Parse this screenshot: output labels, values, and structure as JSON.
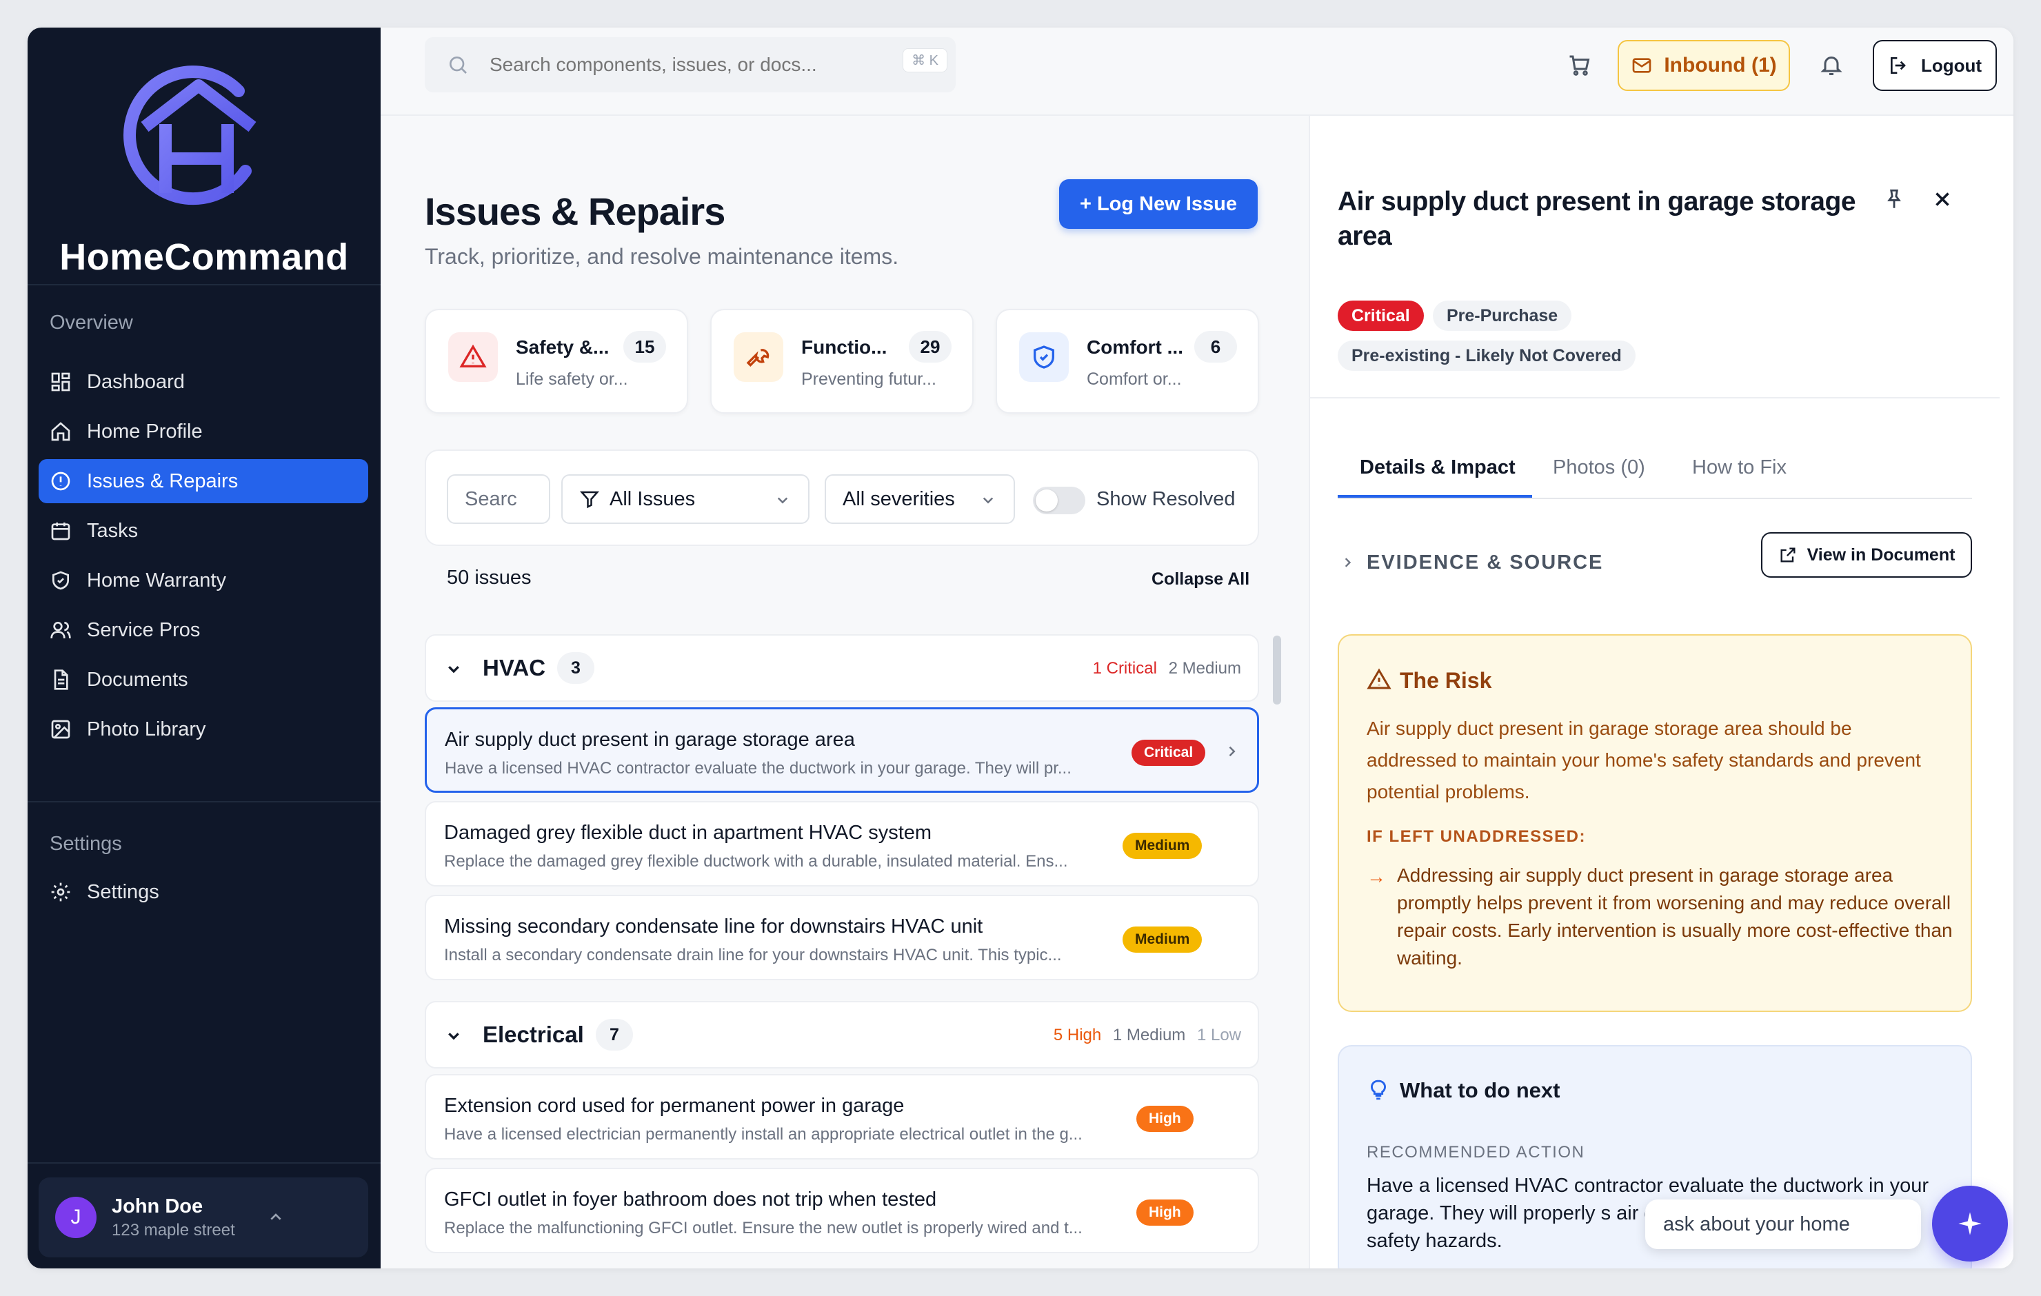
{
  "brand": {
    "name": "HomeCommand",
    "colors": {
      "logo": "#6d6cf5",
      "accent": "#2563eb"
    }
  },
  "sidebar": {
    "overview_label": "Overview",
    "items": [
      {
        "label": "Dashboard",
        "icon": "grid-icon"
      },
      {
        "label": "Home Profile",
        "icon": "home-icon"
      },
      {
        "label": "Issues & Repairs",
        "icon": "alert-circle-icon",
        "active": true
      },
      {
        "label": "Tasks",
        "icon": "calendar-icon"
      },
      {
        "label": "Home Warranty",
        "icon": "shield-check-icon"
      },
      {
        "label": "Service Pros",
        "icon": "users-icon"
      },
      {
        "label": "Documents",
        "icon": "document-icon"
      },
      {
        "label": "Photo Library",
        "icon": "image-icon"
      }
    ],
    "settings_section": "Settings",
    "settings_item": "Settings",
    "user": {
      "initial": "J",
      "name": "John Doe",
      "address": "123 maple street"
    }
  },
  "topbar": {
    "search_placeholder": "Search components, issues, or docs...",
    "shortcut": "⌘ K",
    "inbound_label": "Inbound",
    "inbound_count": "(1)",
    "logout_label": "Logout"
  },
  "main": {
    "title": "Issues & Repairs",
    "subtitle": "Track, prioritize, and resolve maintenance items.",
    "log_button": "+ Log New Issue",
    "stats": [
      {
        "name": "Safety &...",
        "count": "15",
        "desc": "Life safety or...",
        "icon": "warning-triangle-icon",
        "color": "#dc2626",
        "bg": "#fdecec"
      },
      {
        "name": "Functio...",
        "count": "29",
        "desc": "Preventing futur...",
        "icon": "wrench-icon",
        "color": "#c2410c",
        "bg": "#fff3e0"
      },
      {
        "name": "Comfort ...",
        "count": "6",
        "desc": "Comfort or...",
        "icon": "shield-check-icon",
        "color": "#2563eb",
        "bg": "#eaf1fe"
      }
    ],
    "filters": {
      "search_placeholder": "Searc",
      "type_value": "All Issues",
      "severity_value": "All severities",
      "show_resolved_label": "Show Resolved"
    },
    "issues_count": "50 issues",
    "collapse_all": "Collapse All",
    "groups": [
      {
        "name": "HVAC",
        "count": "3",
        "summary": [
          {
            "text": "1 Critical",
            "kind": "crit"
          },
          {
            "text": "2 Medium",
            "kind": "med"
          }
        ],
        "issues": [
          {
            "title": "Air supply duct present in garage storage area",
            "desc": "Have a licensed HVAC contractor evaluate the ductwork in your garage. They will pr...",
            "severity": "Critical",
            "selected": true
          },
          {
            "title": "Damaged grey flexible duct in apartment HVAC system",
            "desc": "Replace the damaged grey flexible ductwork with a durable, insulated material. Ens...",
            "severity": "Medium"
          },
          {
            "title": "Missing secondary condensate line for downstairs HVAC unit",
            "desc": "Install a secondary condensate drain line for your downstairs HVAC unit. This typic...",
            "severity": "Medium"
          }
        ]
      },
      {
        "name": "Electrical",
        "count": "7",
        "summary": [
          {
            "text": "5 High",
            "kind": "high"
          },
          {
            "text": "1 Medium",
            "kind": "med"
          },
          {
            "text": "1 Low",
            "kind": "low"
          }
        ],
        "issues": [
          {
            "title": "Extension cord used for permanent power in garage",
            "desc": "Have a licensed electrician permanently install an appropriate electrical outlet in the g...",
            "severity": "High"
          },
          {
            "title": "GFCI outlet in foyer bathroom does not trip when tested",
            "desc": "Replace the malfunctioning GFCI outlet. Ensure the new outlet is properly wired and t...",
            "severity": "High"
          }
        ]
      }
    ]
  },
  "detail": {
    "title": "Air supply duct present in garage storage area",
    "tags": [
      "Critical",
      "Pre-Purchase",
      "Pre-existing - Likely Not Covered"
    ],
    "tabs": [
      "Details & Impact",
      "Photos (0)",
      "How to Fix"
    ],
    "evidence_label": "EVIDENCE & SOURCE",
    "view_doc": "View in Document",
    "risk": {
      "title": "The Risk",
      "body": "Air supply duct present in garage storage area should be addressed to maintain your home's safety standards and prevent potential problems.",
      "subheading": "IF LEFT UNADDRESSED:",
      "consequence": "Addressing air supply duct present in garage storage area promptly helps prevent it from worsening and may reduce overall repair costs. Early intervention is usually more cost-effective than waiting."
    },
    "next": {
      "title": "What to do next",
      "subheading": "RECOMMENDED ACTION",
      "body": "Have a licensed HVAC contractor evaluate the ductwork in your garage. They will properly s air ducts that are present in the g safety hazards."
    }
  },
  "assistant": {
    "placeholder": "ask about your home"
  }
}
